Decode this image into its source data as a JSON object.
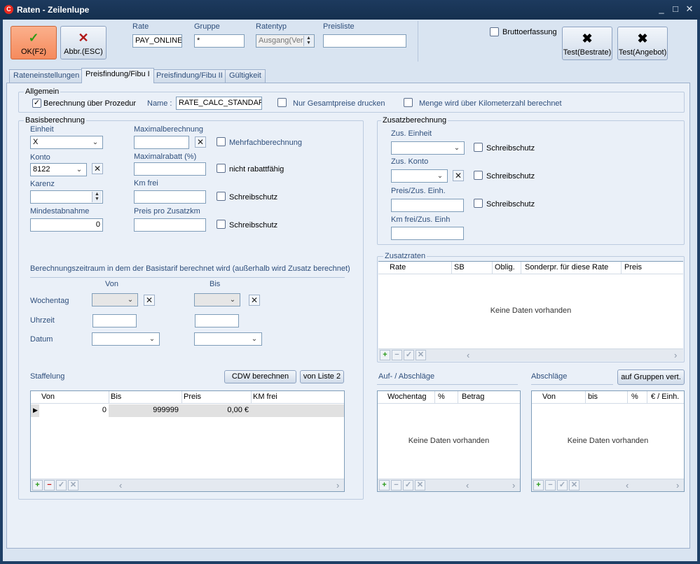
{
  "window": {
    "title": "Raten - Zeilenlupe",
    "app_icon": "C",
    "min": "_",
    "max": "□",
    "close": "✕"
  },
  "toolbar": {
    "ok_label": "OK(F2)",
    "cancel_label": "Abbr.(ESC)",
    "test_bestrate_label": "Test(Bestrate)",
    "test_angebot_label": "Test(Angebot)",
    "bruttoerfassung_label": "Bruttoerfassung"
  },
  "header": {
    "rate_label": "Rate",
    "rate_value": "PAY_ONLINE",
    "gruppe_label": "Gruppe",
    "gruppe_value": "*",
    "ratentyp_label": "Ratentyp",
    "ratentyp_value": "Ausgang(Ver",
    "preisliste_label": "Preisliste",
    "preisliste_value": ""
  },
  "tabs": [
    {
      "label": "Rateneinstellungen"
    },
    {
      "label": "Preisfindung/Fibu I"
    },
    {
      "label": "Preisfindung/Fibu II"
    },
    {
      "label": "Gültigkeit"
    }
  ],
  "allgemein": {
    "title": "Allgemein",
    "prozedur_label": "Berechnung über Prozedur",
    "prozedur_checked": "✓",
    "name_label": "Name :",
    "name_value": "RATE_CALC_STANDAR",
    "gesamtpreise_label": "Nur Gesamtpreise drucken",
    "km_label": "Menge wird über Kilometerzahl berechnet"
  },
  "basis": {
    "title": "Basisberechnung",
    "einheit_label": "Einheit",
    "einheit_value": "X",
    "konto_label": "Konto",
    "konto_value": "8122",
    "karenz_label": "Karenz",
    "karenz_value": "",
    "mindestabnahme_label": "Mindestabnahme",
    "mindestabnahme_value": "0",
    "maximalberechnung_label": "Maximalberechnung",
    "maximalberechnung_value": "",
    "maximalrabatt_label": "Maximalrabatt (%)",
    "maximalrabatt_value": "",
    "kmfrei_label": "Km frei",
    "kmfrei_value": "",
    "preiszusatzkm_label": "Preis pro Zusatzkm",
    "preiszusatzkm_value": "",
    "mehrfach_label": "Mehrfachberechnung",
    "nicht_rabatt_label": "nicht rabattfähig",
    "schreibschutz_label": "Schreibschutz"
  },
  "zeitraum": {
    "title": "Berechnungszeitraum in dem der Basistarif berechnet wird (außerhalb wird Zusatz berechnet)",
    "von_label": "Von",
    "bis_label": "Bis",
    "wochentag_label": "Wochentag",
    "uhrzeit_label": "Uhrzeit",
    "datum_label": "Datum"
  },
  "staffelung": {
    "title": "Staffelung",
    "cdw_label": "CDW berechnen",
    "liste2_label": "von Liste 2",
    "columns": [
      "Von",
      "Bis",
      "Preis",
      "KM frei"
    ],
    "rows": [
      {
        "von": "0",
        "bis": "999999",
        "preis": "0,00 €",
        "kmfrei": ""
      }
    ]
  },
  "zusatz": {
    "title": "Zusatzberechnung",
    "einheit_label": "Zus. Einheit",
    "konto_label": "Zus. Konto",
    "preis_label": "Preis/Zus. Einh.",
    "kmfrei_label": "Km frei/Zus. Einh",
    "schreibschutz_label": "Schreibschutz"
  },
  "zusatzraten": {
    "title": "Zusatzraten",
    "columns": [
      "Rate",
      "SB",
      "Oblig.",
      "Sonderpr. für diese Rate",
      "Preis"
    ],
    "empty": "Keine Daten vorhanden"
  },
  "aufab": {
    "title": "Auf- / Abschläge",
    "columns": [
      "Wochentag",
      "%",
      "Betrag"
    ],
    "empty": "Keine Daten vorhanden"
  },
  "abschlaege": {
    "title": "Abschläge",
    "gruppen_label": "auf Gruppen vert.",
    "columns": [
      "Von",
      "bis",
      "%",
      "€ / Einh."
    ],
    "empty": "Keine Daten vorhanden"
  },
  "footer": {
    "add": "+",
    "remove": "−",
    "ok": "✓",
    "cancel": "✕",
    "left": "‹",
    "right": "›",
    "clear": "✕",
    "dd": "⌄",
    "spin_up": "▲",
    "spin_down": "▼",
    "row_marker": "▶"
  }
}
